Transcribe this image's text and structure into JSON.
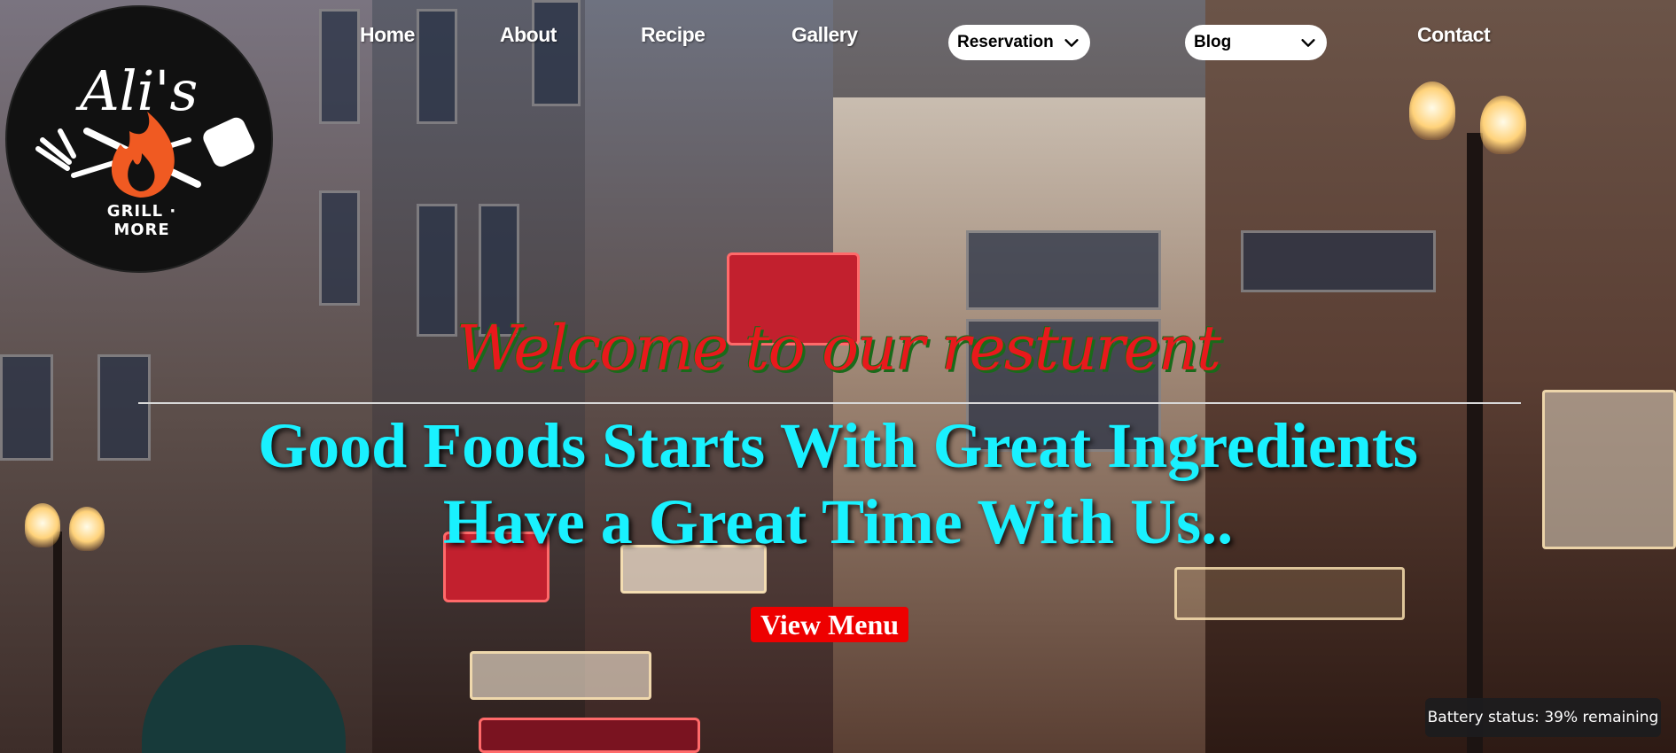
{
  "logo": {
    "brand_name": "Ali's",
    "tagline": "GRILL · MORE",
    "colors": {
      "background": "#111111",
      "flame": "#f05a22",
      "text": "#ffffff"
    }
  },
  "nav": {
    "home": "Home",
    "about": "About",
    "recipe": "Recipe",
    "gallery": "Gallery",
    "reservation": "Reservation",
    "blog": "Blog",
    "contact": "Contact"
  },
  "hero": {
    "welcome": "Welcome to our resturent",
    "headline_line1": "Good Foods Starts With Great Ingredients",
    "headline_line2": "Have a Great Time With Us..",
    "cta_label": "View Menu"
  },
  "status": {
    "battery": "Battery status: 39% remaining"
  },
  "colors": {
    "welcome_text": "#e8191c",
    "welcome_shadow": "#1a6a1a",
    "headline_text": "#19f1ff",
    "cta_background": "#ee0000"
  },
  "icons": {
    "reservation_dropdown": "chevron-down-icon",
    "blog_dropdown": "chevron-down-icon"
  }
}
